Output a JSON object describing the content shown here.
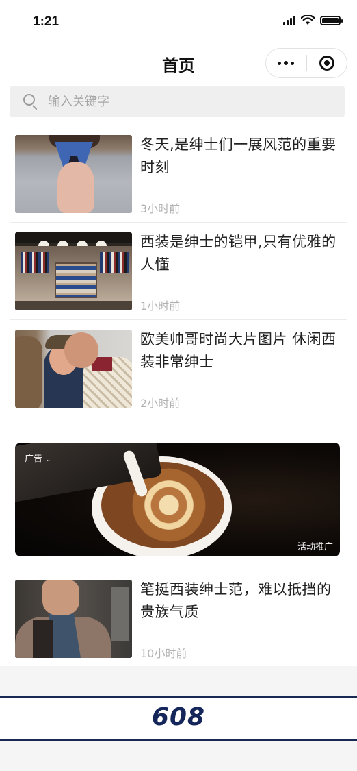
{
  "status_bar": {
    "time": "1:21",
    "icons": [
      "signal-icon",
      "wifi-icon",
      "battery-icon"
    ]
  },
  "nav": {
    "title": "首页",
    "capsule_icons": [
      "more-icon",
      "close-target-icon"
    ]
  },
  "search": {
    "placeholder": "输入关键字",
    "value": ""
  },
  "feed": {
    "items": [
      {
        "title": "冬天,是绅士们一展风范的重要时刻",
        "time": "3小时前",
        "image": "man-gray-suit-tie"
      },
      {
        "title": "西装是绅士的铠甲,只有优雅的人懂",
        "time": "1小时前",
        "image": "menswear-store-interior"
      },
      {
        "title": "欧美帅哥时尚大片图片 休闲西装非常绅士",
        "time": "2小时前",
        "image": "two-gentlemen-street"
      }
    ],
    "ad": {
      "label": "广告",
      "tag": "活动推广",
      "image": "latte-art-coffee"
    },
    "last_item": {
      "title": "笔挺西装绅士范，难以抵挡的贵族气质",
      "time": "10小时前",
      "image": "man-tweed-jacket-scarf"
    }
  },
  "overlay": {
    "number": "608"
  },
  "colors": {
    "accent_navy": "#182a54",
    "text_primary": "#222222",
    "text_secondary": "#b2b2b2",
    "search_bg": "#efefef"
  }
}
